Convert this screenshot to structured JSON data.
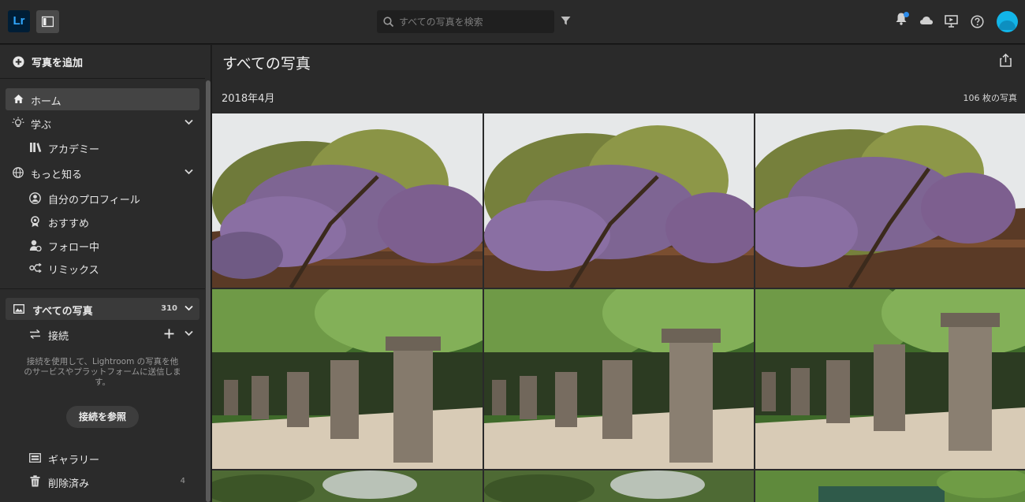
{
  "app": {
    "logo": "Lr"
  },
  "topbar": {
    "search_placeholder": "すべての写真を検索",
    "icons": [
      "panel-toggle-icon",
      "search-icon",
      "filter-icon",
      "bell-icon",
      "cloud-icon",
      "present-icon",
      "help-icon",
      "avatar"
    ]
  },
  "sidebar": {
    "add_photos": "写真を追加",
    "home": "ホーム",
    "learn": "学ぶ",
    "academy": "アカデミー",
    "discover_more": "もっと知る",
    "my_profile": "自分のプロフィール",
    "recommended": "おすすめ",
    "following": "フォロー中",
    "remix": "リミックス",
    "all_photos": "すべての写真",
    "all_photos_count": "310",
    "connections": "接続",
    "connections_help": "接続を使用して、Lightroom の写真を他のサービスやプラットフォームに送信します。",
    "browse_connections": "接続を参照",
    "gallery": "ギャラリー",
    "deleted": "削除済み",
    "deleted_count": "4"
  },
  "main": {
    "title": "すべての写真",
    "date_group": "2018年4月",
    "photo_count": "106 枚の写真"
  },
  "colors": {
    "accent": "#31a8ff",
    "avatar": "#12b5e8",
    "background": "#2a2a2a"
  }
}
